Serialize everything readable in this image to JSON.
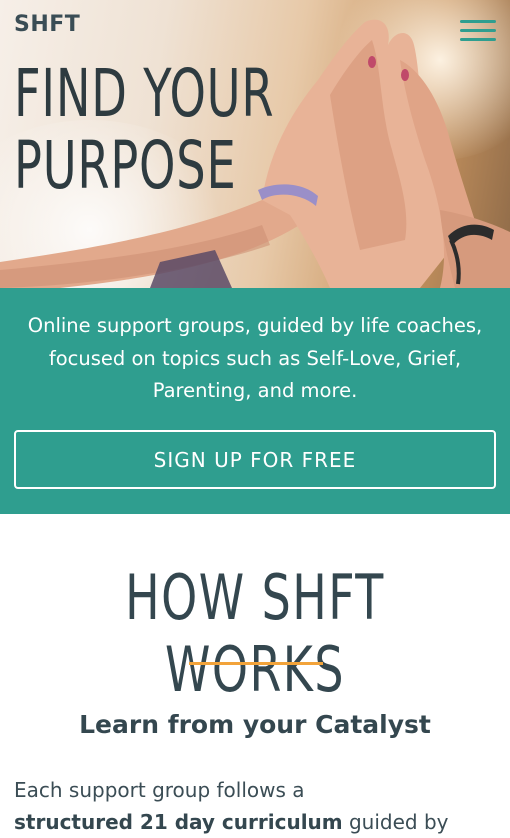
{
  "header": {
    "logo": "SHFT",
    "menu_icon": "hamburger-menu-icon"
  },
  "hero": {
    "title_line1": "FIND YOUR",
    "title_line2": "PURPOSE"
  },
  "band": {
    "tagline": "Online support groups, guided by life coaches, focused on topics such as Self-Love, Grief, Parenting, and more.",
    "cta_label": "SIGN UP FOR FREE"
  },
  "how_it_works": {
    "title": "HOW SHFT WORKS",
    "subheading": "Learn from your Catalyst",
    "body_prefix": "Each support group follows a",
    "body_bold": "structured 21 day curriculum",
    "body_suffix": " guided by"
  },
  "colors": {
    "teal": "#2f9e8f",
    "dark_slate": "#34474f",
    "accent_orange": "#f2a33a"
  }
}
